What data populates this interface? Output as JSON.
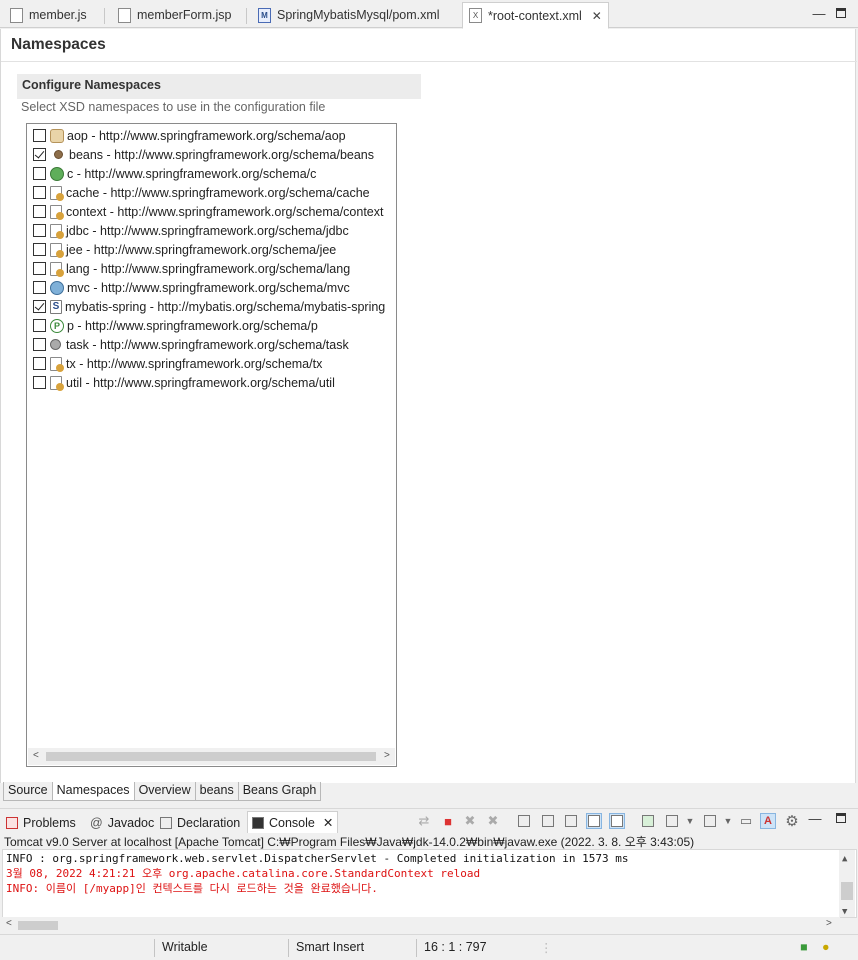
{
  "editor_tabs": [
    {
      "label": "member.js",
      "icon": "js-file-icon"
    },
    {
      "label": "memberForm.jsp",
      "icon": "jsp-file-icon"
    },
    {
      "label": "SpringMybatisMysql/pom.xml",
      "icon": "maven-pom-icon"
    },
    {
      "label": "*root-context.xml",
      "icon": "xml-file-icon",
      "active": true
    }
  ],
  "page": {
    "title": "Namespaces",
    "section_title": "Configure Namespaces",
    "section_description": "Select XSD namespaces to use in the configuration file"
  },
  "namespaces": [
    {
      "label": "aop - http://www.springframework.org/schema/aop",
      "checked": false
    },
    {
      "label": "beans - http://www.springframework.org/schema/beans",
      "checked": true
    },
    {
      "label": "c - http://www.springframework.org/schema/c",
      "checked": false
    },
    {
      "label": "cache - http://www.springframework.org/schema/cache",
      "checked": false
    },
    {
      "label": "context - http://www.springframework.org/schema/context",
      "checked": false
    },
    {
      "label": "jdbc - http://www.springframework.org/schema/jdbc",
      "checked": false
    },
    {
      "label": "jee - http://www.springframework.org/schema/jee",
      "checked": false
    },
    {
      "label": "lang - http://www.springframework.org/schema/lang",
      "checked": false
    },
    {
      "label": "mvc - http://www.springframework.org/schema/mvc",
      "checked": false
    },
    {
      "label": "mybatis-spring - http://mybatis.org/schema/mybatis-spring",
      "checked": true
    },
    {
      "label": "p - http://www.springframework.org/schema/p",
      "checked": false
    },
    {
      "label": "task - http://www.springframework.org/schema/task",
      "checked": false
    },
    {
      "label": "tx - http://www.springframework.org/schema/tx",
      "checked": false
    },
    {
      "label": "util - http://www.springframework.org/schema/util",
      "checked": false
    }
  ],
  "bottom_tabs": [
    "Source",
    "Namespaces",
    "Overview",
    "beans",
    "Beans Graph"
  ],
  "active_bottom_tab": "Namespaces",
  "console_tabs": [
    {
      "label": "Problems",
      "icon": "problems-icon"
    },
    {
      "label": "Javadoc",
      "icon": "javadoc-icon"
    },
    {
      "label": "Declaration",
      "icon": "declaration-icon"
    },
    {
      "label": "Console",
      "icon": "console-icon",
      "active": true
    }
  ],
  "console": {
    "description": "Tomcat v9.0 Server at localhost [Apache Tomcat] C:₩Program Files₩Java₩jdk-14.0.2₩bin₩javaw.exe  (2022. 3. 8. 오후 3:43:05)",
    "lines": [
      {
        "text": "INFO : org.springframework.web.servlet.DispatcherServlet - Completed initialization in 1573 ms",
        "kind": "info"
      },
      {
        "text": "3월 08, 2022 4:21:21 오후 org.apache.catalina.core.StandardContext reload",
        "kind": "err"
      },
      {
        "text": "INFO: 이름이 [/myapp]인 컨텍스트를 다시 로드하는 것을 완료했습니다.",
        "kind": "err"
      }
    ]
  },
  "status": {
    "writable": "Writable",
    "insert_mode": "Smart Insert",
    "position": "16 : 1 : 797"
  },
  "colors": {
    "error_text": "#d11111",
    "selection_blue": "#cde3f7"
  }
}
